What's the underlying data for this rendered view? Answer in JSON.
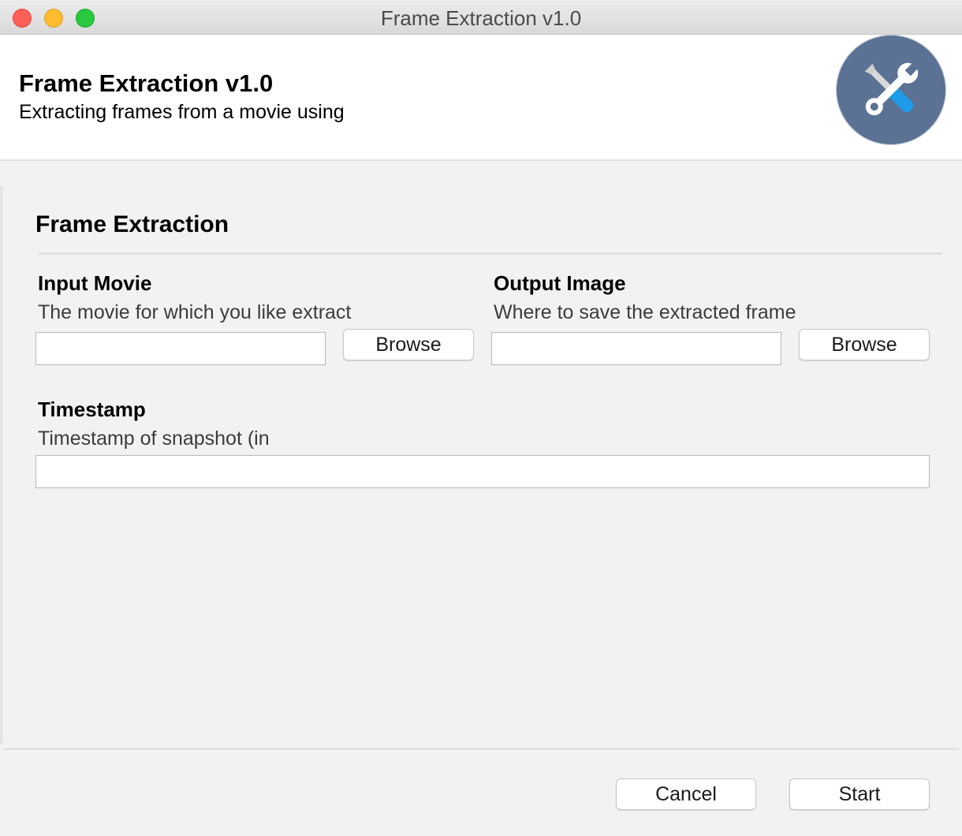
{
  "window": {
    "title": "Frame Extraction v1.0"
  },
  "header": {
    "title": "Frame Extraction v1.0",
    "subtitle": "Extracting frames from a movie using",
    "logo_icon": "tools-icon",
    "logo_color": "#5b7294"
  },
  "section": {
    "title": "Frame Extraction"
  },
  "fields": {
    "input_movie": {
      "label": "Input Movie",
      "description": "The movie for which you like extract",
      "value": "",
      "browse_label": "Browse"
    },
    "output_image": {
      "label": "Output Image",
      "description": "Where to save the extracted frame",
      "value": "",
      "browse_label": "Browse"
    },
    "timestamp": {
      "label": "Timestamp",
      "description": "Timestamp of snapshot (in",
      "value": ""
    }
  },
  "footer": {
    "cancel_label": "Cancel",
    "start_label": "Start"
  }
}
